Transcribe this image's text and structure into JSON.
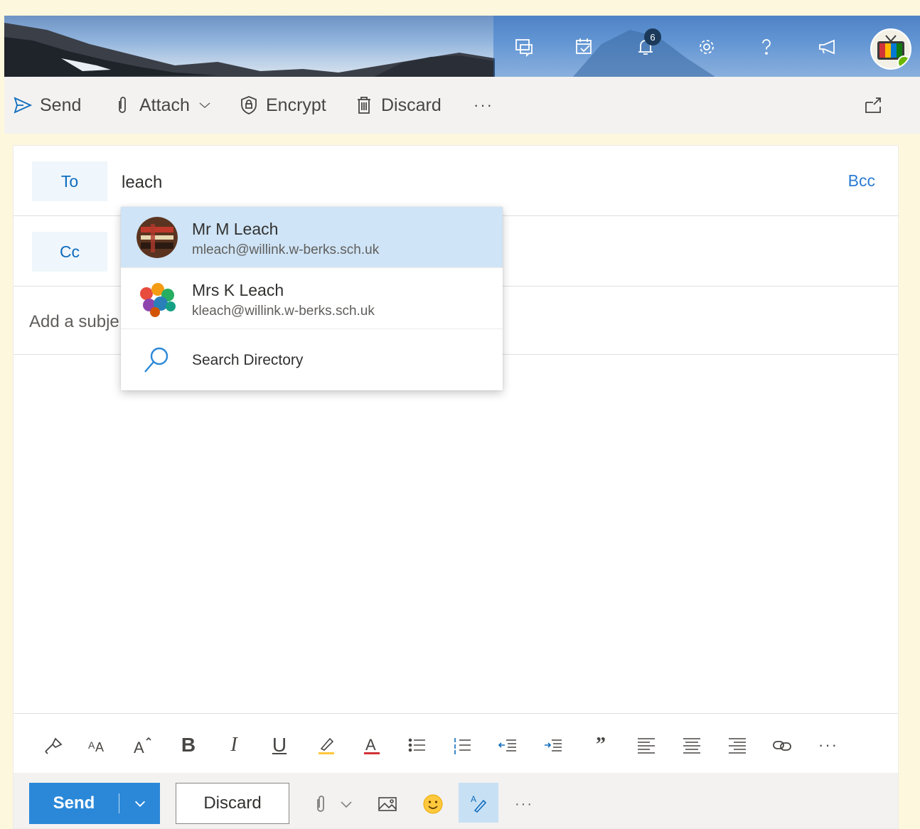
{
  "header": {
    "notification_count": "6",
    "icons": [
      "chat-icon",
      "calendar-check-icon",
      "bell-icon",
      "gear-icon",
      "help-icon",
      "megaphone-icon"
    ]
  },
  "toolbar": {
    "send_label": "Send",
    "attach_label": "Attach",
    "encrypt_label": "Encrypt",
    "discard_label": "Discard",
    "more_label": "···"
  },
  "compose": {
    "to_label": "To",
    "to_value": "leach",
    "bcc_label": "Bcc",
    "cc_label": "Cc",
    "subject_placeholder": "Add a subje"
  },
  "suggestions": [
    {
      "name": "Mr M Leach",
      "email": "mleach@willink.w-berks.sch.uk",
      "selected": true
    },
    {
      "name": "Mrs K Leach",
      "email": "kleach@willink.w-berks.sch.uk",
      "selected": false
    }
  ],
  "search_directory_label": "Search Directory",
  "format_bar": {
    "bold": "B",
    "italic": "I",
    "underline": "U",
    "quote": "”",
    "more": "···"
  },
  "bottom": {
    "send_label": "Send",
    "discard_label": "Discard",
    "more": "···"
  },
  "colors": {
    "accent": "#2b88d8",
    "selected_row": "#cfe4f6",
    "page_bg": "#fdf8dd"
  }
}
